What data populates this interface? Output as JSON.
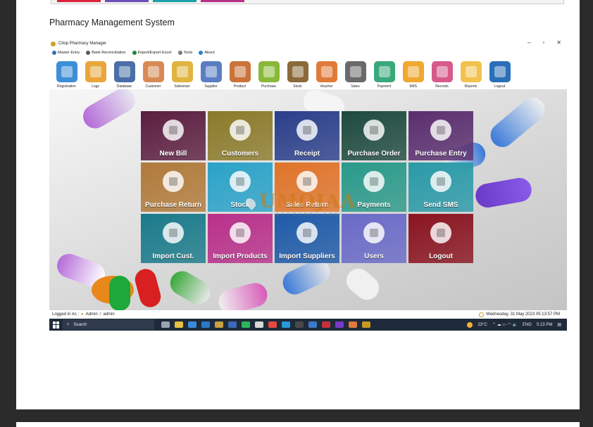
{
  "caption": "Pharmacy Management System",
  "window": {
    "title": "Citop Pharmacy Manager",
    "minimize": "–",
    "maximize": "▫",
    "close": "✕"
  },
  "menu": [
    {
      "label": "Master Entry",
      "icon": "users-icon",
      "color": "#3b6ea8"
    },
    {
      "label": "Bank Reconciliation",
      "icon": "bank-icon",
      "color": "#5a5a5a"
    },
    {
      "label": "Import/Export Excel",
      "icon": "excel-icon",
      "color": "#1d8a3a"
    },
    {
      "label": "Tools",
      "icon": "tools-icon",
      "color": "#7a7a7a"
    },
    {
      "label": "About",
      "icon": "info-icon",
      "color": "#2a7fd4"
    }
  ],
  "toolbar": [
    {
      "label": "Registration",
      "icon": "registration-icon",
      "color": "#3d8fd6"
    },
    {
      "label": "Logs",
      "icon": "logs-icon",
      "color": "#e8a63b"
    },
    {
      "label": "Database",
      "icon": "database-icon",
      "color": "#4a6fa8"
    },
    {
      "label": "Customer",
      "icon": "customer-icon",
      "color": "#d88a55"
    },
    {
      "label": "Salesman",
      "icon": "salesman-icon",
      "color": "#e0b441"
    },
    {
      "label": "Supplier",
      "icon": "supplier-icon",
      "color": "#5b7ec2"
    },
    {
      "label": "Product",
      "icon": "product-icon",
      "color": "#c9743a"
    },
    {
      "label": "Purchase",
      "icon": "purchase-icon",
      "color": "#8ab83a"
    },
    {
      "label": "Stock",
      "icon": "stock-icon",
      "color": "#8a6a3a"
    },
    {
      "label": "Voucher",
      "icon": "voucher-icon",
      "color": "#e07a3a"
    },
    {
      "label": "Sales",
      "icon": "sales-icon",
      "color": "#6a6a6a"
    },
    {
      "label": "Payment",
      "icon": "payment-icon",
      "color": "#3aa87a"
    },
    {
      "label": "SMS",
      "icon": "sms-icon",
      "color": "#f0a830"
    },
    {
      "label": "Records",
      "icon": "records-icon",
      "color": "#d65a8a"
    },
    {
      "label": "Reports",
      "icon": "reports-icon",
      "color": "#f2c14e"
    },
    {
      "label": "Logout",
      "icon": "logout-icon",
      "color": "#2a6fb8"
    }
  ],
  "tiles": [
    {
      "label": "New Bill",
      "icon": "bill-icon",
      "color": "#5a1d3e"
    },
    {
      "label": "Customers",
      "icon": "customers-icon",
      "color": "#8a7a2a"
    },
    {
      "label": "Receipt",
      "icon": "receipt-icon",
      "color": "#2a3e8a"
    },
    {
      "label": "Purchase Order",
      "icon": "purchase-order-icon",
      "color": "#1e4a3e"
    },
    {
      "label": "Purchase Entry",
      "icon": "purchase-entry-icon",
      "color": "#5a2e6e"
    },
    {
      "label": "Purchase Return",
      "icon": "purchase-return-icon",
      "color": "#b07a3a"
    },
    {
      "label": "Stock",
      "icon": "stock-icon",
      "color": "#2aa2c8"
    },
    {
      "label": "Sales Return",
      "icon": "sales-return-icon",
      "color": "#e0742a"
    },
    {
      "label": "Payments",
      "icon": "payments-icon",
      "color": "#2a9a8a"
    },
    {
      "label": "Send SMS",
      "icon": "send-sms-icon",
      "color": "#2a9aa8"
    },
    {
      "label": "Import Cust.",
      "icon": "import-customers-icon",
      "color": "#1a7a8a"
    },
    {
      "label": "Import Products",
      "icon": "import-products-icon",
      "color": "#b8308a"
    },
    {
      "label": "Import Suppliers",
      "icon": "import-suppliers-icon",
      "color": "#1e5aa8"
    },
    {
      "label": "Users",
      "icon": "users-icon",
      "color": "#6a6ac8"
    },
    {
      "label": "Logout",
      "icon": "logout-icon",
      "color": "#8a1420"
    }
  ],
  "watermark": {
    "brand": "UMOJAA",
    "tagline": "ACCOUNTS ADS"
  },
  "status": {
    "logged_in_label": "Logged in As :",
    "role": "Admin",
    "separator": "/",
    "username": "admin",
    "datetime": "Wednesday, 31 May 2023 05:13:57 PM"
  },
  "taskbar": {
    "search_placeholder": "Search",
    "temperature": "23°C",
    "language": "ENG",
    "time": "5:13 PM"
  }
}
